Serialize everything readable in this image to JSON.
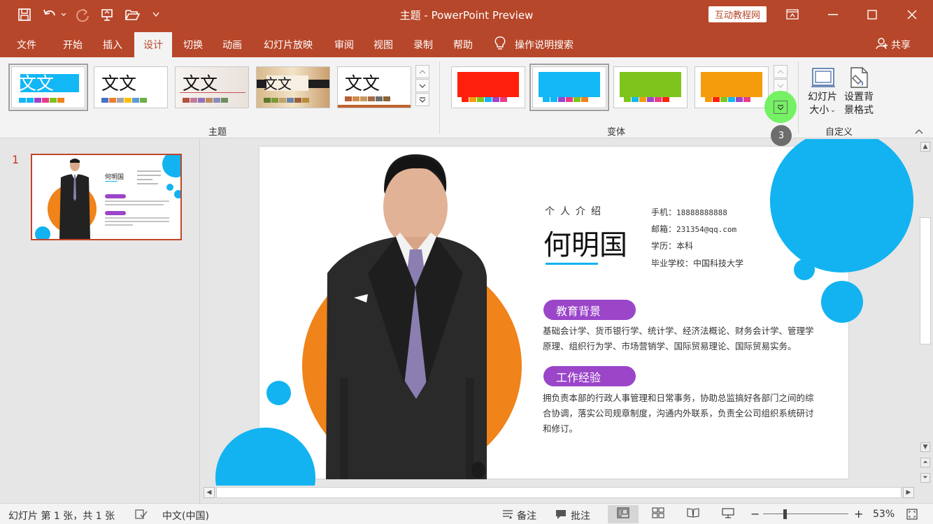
{
  "app": {
    "title": "主题 - PowerPoint Preview",
    "brand_badge": "互动教程网"
  },
  "menu": {
    "tabs": [
      "文件",
      "开始",
      "插入",
      "设计",
      "切换",
      "动画",
      "幻灯片放映",
      "审阅",
      "视图",
      "录制",
      "帮助"
    ],
    "active_tab": "设计",
    "search_label": "操作说明搜索",
    "share_label": "共享"
  },
  "ribbon": {
    "themes_group_label": "主题",
    "variants_group_label": "变体",
    "customize_group_label": "自定义",
    "theme_thumb_text": "文文",
    "slide_size_label": [
      "幻灯片",
      "大小"
    ],
    "format_bg_label": [
      "设置背",
      "景格式"
    ],
    "step_badge": "3",
    "accent_colors": [
      "#ff1f0a",
      "#12b7f5",
      "#7ec41d",
      "#f49c0b"
    ]
  },
  "thumbnails": {
    "slide_number": "1"
  },
  "slide": {
    "intro_label": "个人介绍",
    "name": "何明国",
    "info": [
      {
        "label": "手机：",
        "value": "18888888888"
      },
      {
        "label": "邮箱：",
        "value": "231354@qq.com"
      },
      {
        "label": "学历：",
        "value": "本科"
      },
      {
        "label": "毕业学校：",
        "value": "中国科技大学"
      }
    ],
    "education": {
      "heading": "教育背景",
      "lines": [
        "基础会计学、货币银行学、统计学、经济法概论、财务会计学、管理学",
        "原理、组织行为学、市场营销学、国际贸易理论、国际贸易实务。"
      ]
    },
    "work": {
      "heading": "工作经验",
      "lines": [
        "拥负责本部的行政人事管理和日常事务，协助总监搞好各部门之间的综",
        "合协调，落实公司规章制度，沟通内外联系，负责全公司组织系统研讨",
        "和修订。"
      ]
    },
    "colors": {
      "blue": "#12b3f0",
      "orange": "#f08319",
      "purple": "#9b45c9"
    }
  },
  "status": {
    "slide_info": "幻灯片 第 1 张，共 1 张",
    "language": "中文(中国)",
    "notes": "备注",
    "comments": "批注",
    "zoom": "53%"
  }
}
